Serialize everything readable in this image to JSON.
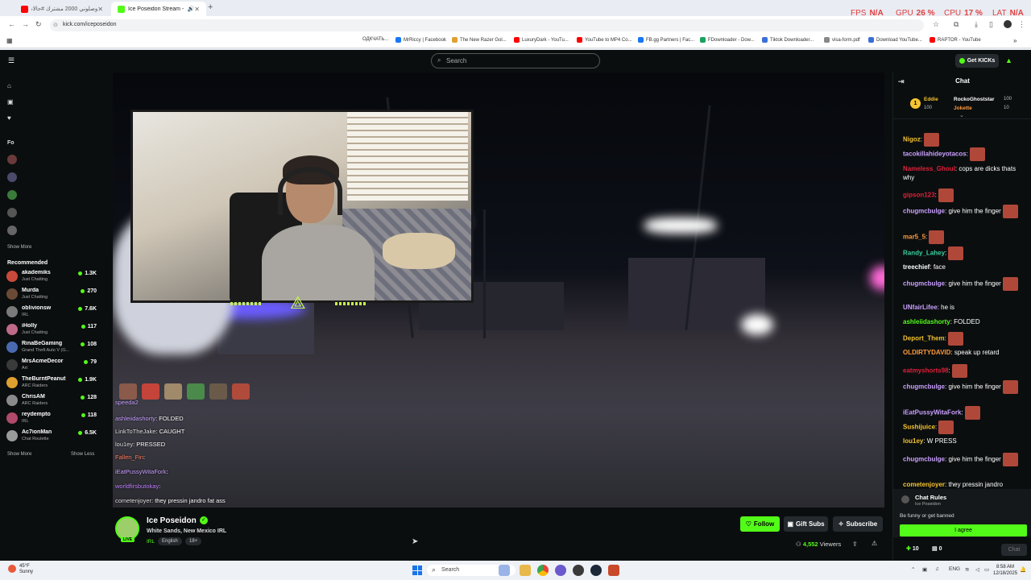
{
  "browser": {
    "tabs": [
      {
        "title": "وصلوني 2000 مشترك #حالات",
        "favicon_color": "#ff0000"
      },
      {
        "title": "Ice Poseidon Stream - Watc",
        "favicon_color": "#53fc18"
      }
    ],
    "url": "kick.com/iceposeidon",
    "perf": {
      "fps_label": "FPS",
      "fps": "N/A",
      "gpu_label": "GPU",
      "gpu": "26 %",
      "cpu_label": "CPU",
      "cpu": "17 %",
      "lat_label": "LAT",
      "lat": "N/A"
    },
    "bookmarks": [
      "OДКЧАТЬ...",
      "MrRiccy | Facebook",
      "The New Razer Gol...",
      "LuxuryDark - YouTu...",
      "YouTube to MP4 Co...",
      "FB.gg Partners | Fac...",
      "FDownloader - Dow...",
      "Tiktok Downloader...",
      "visa-form.pdf",
      "Download YouTube...",
      "RAPTOR - YouTube"
    ]
  },
  "topnav": {
    "search_placeholder": "Search",
    "get_kicks": "Get KICKs"
  },
  "sidebar": {
    "following_initial": "Fo",
    "show_more_top": "Show More",
    "recommended_title": "Recommended",
    "recommended": [
      {
        "name": "akademiks",
        "category": "Just Chatting",
        "viewers": "1.3K",
        "color": "#c94a3a"
      },
      {
        "name": "Murda",
        "category": "Just Chatting",
        "viewers": "270",
        "color": "#6b4a35"
      },
      {
        "name": "oblivionsw",
        "category": "IRL",
        "viewers": "7.6K",
        "color": "#7a7a7a"
      },
      {
        "name": "iHolly",
        "category": "Just Chatting",
        "viewers": "117",
        "color": "#c06a8a"
      },
      {
        "name": "RinaBeGaming",
        "category": "Grand Theft Auto V (G...",
        "viewers": "108",
        "color": "#4a6ab0"
      },
      {
        "name": "MrsAcmeDecor",
        "category": "Art",
        "viewers": "79",
        "color": "#3a3a3a"
      },
      {
        "name": "TheBurntPeanut",
        "category": "ARC Raiders",
        "viewers": "1.9K",
        "color": "#e0a030"
      },
      {
        "name": "ChrisAM",
        "category": "ARC Raiders",
        "viewers": "128",
        "color": "#8a8a8a"
      },
      {
        "name": "reydempto",
        "category": "IRL",
        "viewers": "118",
        "color": "#b04a6a"
      },
      {
        "name": "Ac7ionMan",
        "category": "Chat Roulette",
        "viewers": "6.5K",
        "color": "#9a9a9a"
      }
    ],
    "show_more": "Show More",
    "show_less": "Show Less"
  },
  "player": {
    "overlay_chat": [
      {
        "user": "speeda2",
        "text": "",
        "color": "#c9a0ff"
      },
      {
        "user": "ashleiidashorty",
        "text": ": FOLDED",
        "color": "#c9a0ff"
      },
      {
        "user": "LinkToTheJake",
        "text": ": CAUGHT",
        "color": "#dddddd"
      },
      {
        "user": "lou1ey",
        "text": ": PRESSED",
        "color": "#dddddd"
      },
      {
        "user": "Fallen_Fin",
        "text": ":",
        "color": "#ff8060"
      },
      {
        "user": "iEatPussyWitaFork",
        "text": ":",
        "color": "#c9a0ff"
      },
      {
        "user": "worldfirsbutokay",
        "text": ":",
        "color": "#c080ff"
      },
      {
        "user": "cometenjoyer",
        "text": ": they pressin jandro fat ass",
        "color": "#dddddd"
      }
    ]
  },
  "channel": {
    "name": "Ice Poseidon",
    "live_badge": "LIVE",
    "title": "White Sands, New Mexico IRL",
    "category": "IRL",
    "tags": [
      "English",
      "18+"
    ],
    "follow": "Follow",
    "gift_subs": "Gift Subs",
    "subscribe": "Subscribe",
    "viewers": "4,552",
    "viewers_label": "Viewers"
  },
  "chat": {
    "title": "Chat",
    "pinned": {
      "rank": "1",
      "user1": "Eddie",
      "user1_val": "100",
      "user2": "RockoGhoststar",
      "user2_val": "100",
      "user3": "Jokette",
      "user3_val": "10"
    },
    "messages": [
      {
        "user": "Nigoz",
        "text": "",
        "color": "#f4c430",
        "emote": true
      },
      {
        "user": "tacokillahideyotacos",
        "text": "",
        "color": "#c9a0ff",
        "emote": true
      },
      {
        "user": "Nameless_Ghoul",
        "text": "cops are dicks thats why",
        "color": "#e0203a",
        "emote": false
      },
      {
        "user": "gipson123",
        "text": "",
        "color": "#e0203a",
        "emote": true
      },
      {
        "user": "chugmcbulge",
        "text": "give him the finger",
        "color": "#c9a0ff",
        "emote": true
      },
      {
        "user": "mar5_5",
        "text": "",
        "color": "#ff9a3a",
        "emote": true
      },
      {
        "user": "Randy_Lahey",
        "text": "",
        "color": "#3ad0a0",
        "emote": true
      },
      {
        "user": "treechief",
        "text": "face",
        "color": "#ffffff",
        "emote": false
      },
      {
        "user": "chugmcbulge",
        "text": "give him the finger",
        "color": "#c9a0ff",
        "emote": true
      },
      {
        "user": "UNfairLifee",
        "text": "he is",
        "color": "#c9a0ff",
        "emote": false
      },
      {
        "user": "ashleiidashorty",
        "text": "FOLDED",
        "color": "#53fc18",
        "emote": false
      },
      {
        "user": "Deport_Them",
        "text": "",
        "color": "#f4c430",
        "emote": true
      },
      {
        "user": "OLDIRTYDAVID",
        "text": "speak up retard",
        "color": "#ff9a3a",
        "emote": false
      },
      {
        "user": "eatmyshorts98",
        "text": "",
        "color": "#e0203a",
        "emote": true
      },
      {
        "user": "chugmcbulge",
        "text": "give him the finger",
        "color": "#c9a0ff",
        "emote": true
      },
      {
        "user": "iEatPussyWitaFork",
        "text": "",
        "color": "#c9a0ff",
        "emote": true
      },
      {
        "user": "Sushijuice",
        "text": "",
        "color": "#f4c430",
        "emote": true
      },
      {
        "user": "lou1ey",
        "text": "W PRESS",
        "color": "#f4c430",
        "emote": false
      },
      {
        "user": "chugmcbulge",
        "text": "give him the finger",
        "color": "#c9a0ff",
        "emote": true
      },
      {
        "user": "cometenjoyer",
        "text": "they pressin jandro",
        "color": "#f4c430",
        "emote": false
      }
    ],
    "rules_title": "Chat Rules",
    "rules_sub": "Ice Poseidon",
    "rules_body": "Be funny or get banned",
    "agree": "I agree",
    "kicks": "10",
    "box_count": "0",
    "chat_button": "Chat"
  },
  "taskbar": {
    "weather_temp": "45°F",
    "weather_desc": "Sunny",
    "search": "Search",
    "lang": "ENG",
    "time": "8:58 AM",
    "date": "12/18/2025"
  }
}
